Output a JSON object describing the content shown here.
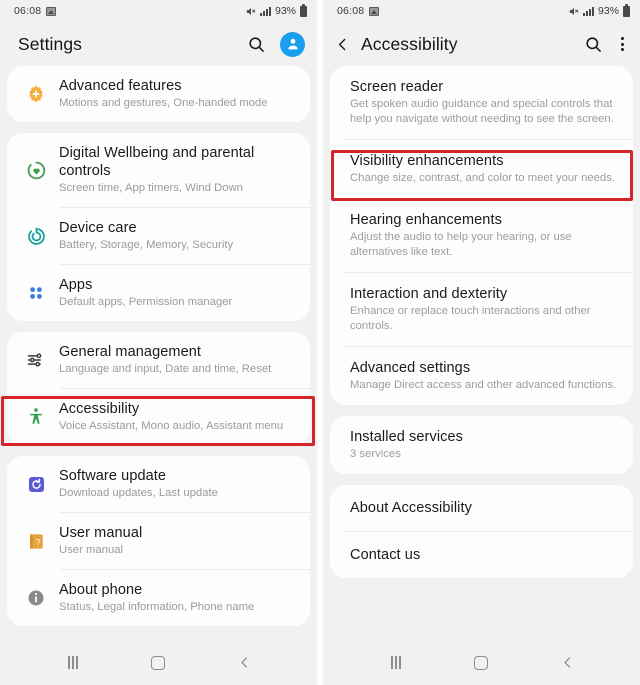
{
  "status_bar": {
    "time": "06:08",
    "battery_percent": "93%",
    "icons": [
      "photo-icon",
      "mute-icon",
      "signal-icon",
      "battery-icon"
    ]
  },
  "left_screen": {
    "appbar": {
      "title": "Settings",
      "search_icon": "search-icon",
      "avatar_icon": "account-avatar-icon"
    },
    "groups": [
      {
        "items": [
          {
            "title": "Advanced features",
            "subtitle": "Motions and gestures, One-handed mode",
            "icon": "advanced-features-icon",
            "icon_color": "#f3ae3d",
            "highlighted": false
          }
        ]
      },
      {
        "items": [
          {
            "title": "Digital Wellbeing and parental controls",
            "subtitle": "Screen time, App timers, Wind Down",
            "icon": "digital-wellbeing-icon",
            "icon_color": "#3f9e52",
            "highlighted": false
          },
          {
            "title": "Device care",
            "subtitle": "Battery, Storage, Memory, Security",
            "icon": "device-care-icon",
            "icon_color": "#14a0a0",
            "highlighted": false
          },
          {
            "title": "Apps",
            "subtitle": "Default apps, Permission manager",
            "icon": "apps-icon",
            "icon_color": "#3b7ddd",
            "highlighted": false
          }
        ]
      },
      {
        "items": [
          {
            "title": "General management",
            "subtitle": "Language and input, Date and time, Reset",
            "icon": "general-management-icon",
            "icon_color": "#3a3a3a",
            "highlighted": false
          },
          {
            "title": "Accessibility",
            "subtitle": "Voice Assistant, Mono audio, Assistant menu",
            "icon": "accessibility-person-icon",
            "icon_color": "#2f9e4f",
            "highlighted": true
          }
        ]
      },
      {
        "items": [
          {
            "title": "Software update",
            "subtitle": "Download updates, Last update",
            "icon": "software-update-icon",
            "icon_color": "#5b5bd6",
            "highlighted": false
          },
          {
            "title": "User manual",
            "subtitle": "User manual",
            "icon": "user-manual-icon",
            "icon_color": "#e8a33d",
            "highlighted": false
          },
          {
            "title": "About phone",
            "subtitle": "Status, Legal information, Phone name",
            "icon": "about-phone-info-icon",
            "icon_color": "#8a8a8a",
            "highlighted": false
          }
        ]
      }
    ]
  },
  "right_screen": {
    "appbar": {
      "title": "Accessibility",
      "back_icon": "back-chevron-icon",
      "search_icon": "search-icon",
      "menu_icon": "kebab-menu-icon"
    },
    "groups": [
      {
        "items": [
          {
            "title": "Screen reader",
            "subtitle": "Get spoken audio guidance and special controls that help you navigate without needing to see the screen.",
            "highlighted": false
          },
          {
            "title": "Visibility enhancements",
            "subtitle": "Change size, contrast, and color to meet your needs.",
            "highlighted": true
          },
          {
            "title": "Hearing enhancements",
            "subtitle": "Adjust the audio to help your hearing, or use alternatives like text.",
            "highlighted": false
          },
          {
            "title": "Interaction and dexterity",
            "subtitle": "Enhance or replace touch interactions and other controls.",
            "highlighted": false
          },
          {
            "title": "Advanced settings",
            "subtitle": "Manage Direct access and other advanced functions.",
            "highlighted": false
          }
        ]
      },
      {
        "items": [
          {
            "title": "Installed services",
            "subtitle": "3 services",
            "subtitle_is_link": true,
            "highlighted": false
          }
        ]
      },
      {
        "items": [
          {
            "title": "About Accessibility",
            "subtitle": "",
            "highlighted": false
          },
          {
            "title": "Contact us",
            "subtitle": "",
            "highlighted": false
          }
        ]
      }
    ]
  },
  "nav_bar": {
    "recents_label": "recents-icon",
    "home_label": "home-icon",
    "back_label": "back-icon"
  },
  "colors": {
    "highlight": "#d6252a",
    "accent_blue": "#1a9ff0",
    "link_blue": "#5b8cb8",
    "page_bg": "#f1f1f1",
    "card_bg": "#fdfdfd"
  }
}
